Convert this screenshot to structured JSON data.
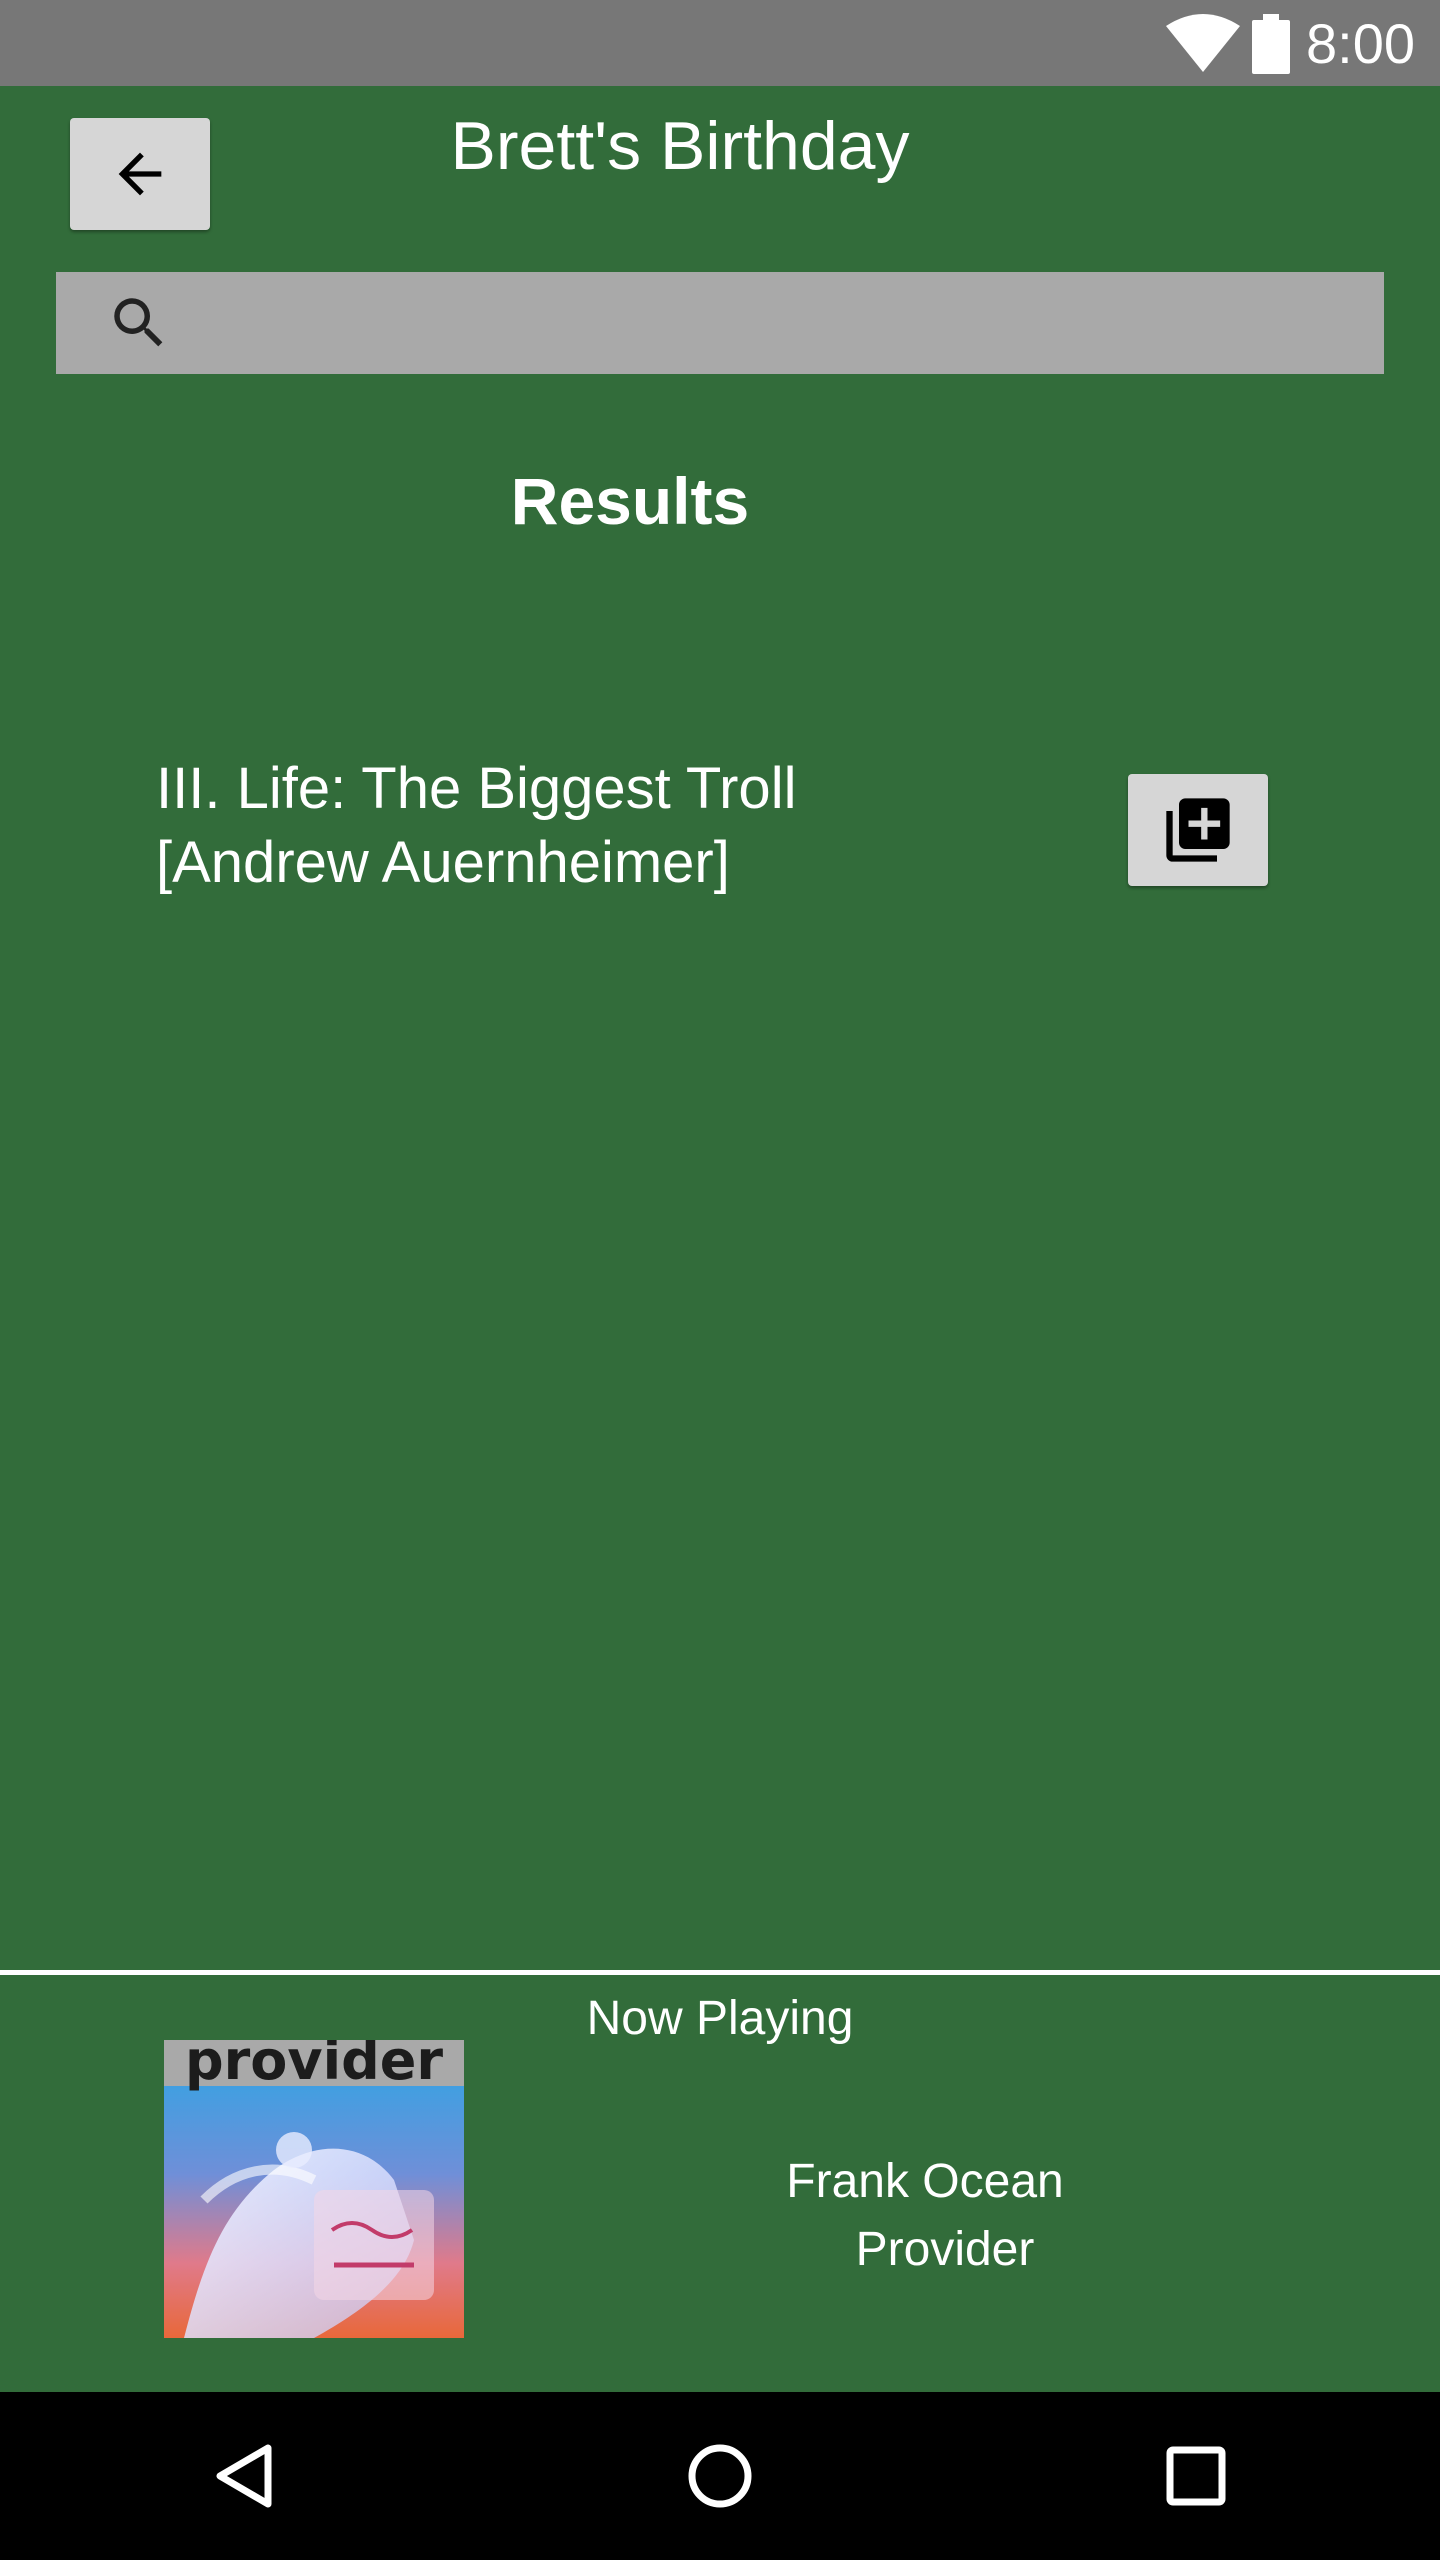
{
  "status_bar": {
    "time": "8:00",
    "wifi_icon": "wifi-icon",
    "battery_icon": "battery-icon"
  },
  "header": {
    "back_icon": "arrow-left-icon",
    "title": "Brett's Birthday"
  },
  "search": {
    "icon": "search-icon",
    "value": "",
    "placeholder": ""
  },
  "results": {
    "heading": "Results",
    "items": [
      {
        "line1": "III. Life: The Biggest Troll",
        "line2": "[Andrew Auernheimer]",
        "action_icon": "add-to-queue-icon"
      }
    ]
  },
  "now_playing": {
    "label": "Now Playing",
    "album_art_text": "provider",
    "artist": "Frank Ocean",
    "track": "Provider"
  },
  "nav_bar": {
    "back_icon": "nav-back-icon",
    "home_icon": "nav-home-icon",
    "recents_icon": "nav-recents-icon"
  },
  "colors": {
    "background": "#326c3a",
    "status_bar": "#777777",
    "search_bar": "#a9a9a9",
    "button": "#d6d6d6",
    "nav_bar": "#000000",
    "text": "#ffffff"
  }
}
